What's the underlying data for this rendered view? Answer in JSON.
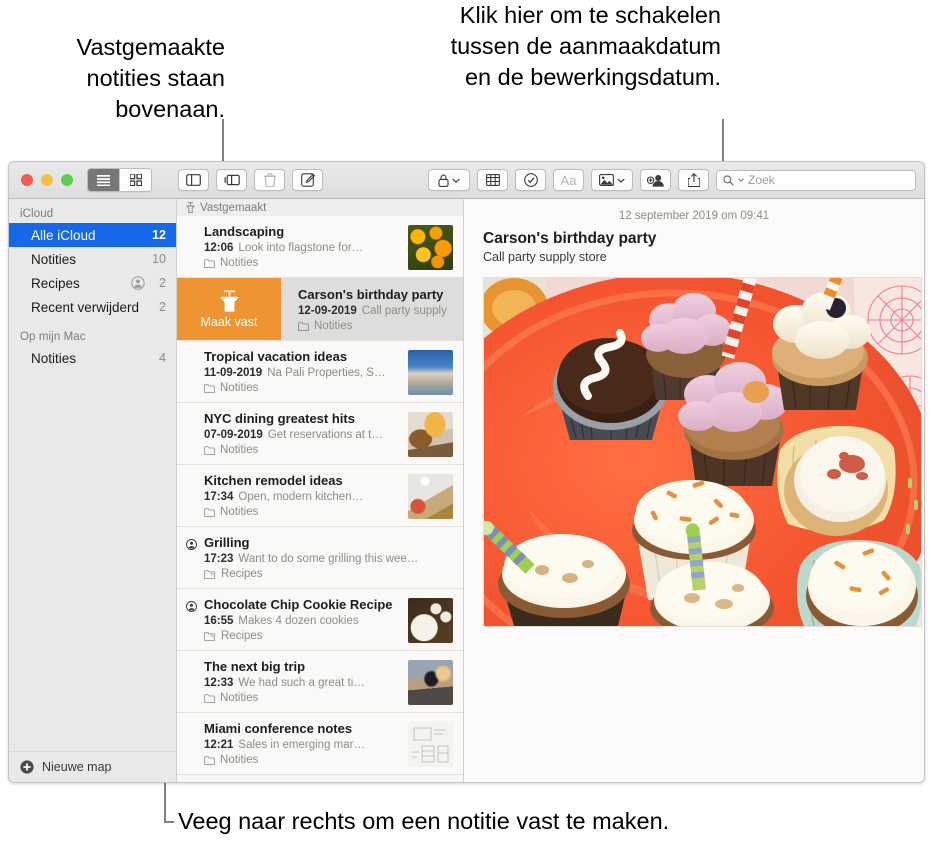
{
  "callouts": {
    "pinned": "Vastgemaakte notities staan bovenaan.",
    "date_toggle": "Klik hier om te schakelen tussen de aanmaakdatum en de bewerkingsdatum.",
    "swipe": "Veeg naar rechts om een notitie vast te maken."
  },
  "toolbar": {
    "window_controls": [
      "close",
      "minimize",
      "maximize"
    ],
    "view_list_label": "list-view",
    "view_grid_label": "gallery-view",
    "buttons": [
      {
        "name": "sidebar-toggle",
        "icon": "sidebar-icon"
      },
      {
        "name": "folders-toggle",
        "icon": "folder-list-icon"
      },
      {
        "name": "delete-note",
        "icon": "trash-icon",
        "disabled": true
      },
      {
        "name": "compose-note",
        "icon": "compose-icon"
      },
      {
        "name": "lock-note",
        "icon": "lock-icon",
        "chevron": true
      },
      {
        "name": "add-table",
        "icon": "table-icon"
      },
      {
        "name": "checklist",
        "icon": "checkmark-circle-icon"
      },
      {
        "name": "format",
        "icon": "aa-icon",
        "disabled": true
      },
      {
        "name": "add-media",
        "icon": "photo-icon",
        "chevron": true
      },
      {
        "name": "add-people",
        "icon": "add-person-icon"
      },
      {
        "name": "share",
        "icon": "share-icon"
      }
    ],
    "search": {
      "placeholder": "Zoek",
      "icon": "search-icon"
    }
  },
  "sidebar": {
    "sections": [
      {
        "header": "iCloud",
        "items": [
          {
            "label": "Alle iCloud",
            "count": "12",
            "selected": true,
            "shared": false
          },
          {
            "label": "Notities",
            "count": "10",
            "selected": false,
            "shared": false
          },
          {
            "label": "Recipes",
            "count": "2",
            "selected": false,
            "shared": true
          },
          {
            "label": "Recent verwijderd",
            "count": "2",
            "selected": false,
            "shared": false
          }
        ]
      },
      {
        "header": "Op mijn Mac",
        "items": [
          {
            "label": "Notities",
            "count": "4",
            "selected": false,
            "shared": false
          }
        ]
      }
    ],
    "new_folder_label": "Nieuwe map"
  },
  "notes_list": {
    "pinned_header": "Vastgemaakt",
    "pin_action_label": "Maak vast",
    "items": [
      {
        "title": "Landscaping",
        "time": "12:06",
        "preview": "Look into flagstone for…",
        "folder": "Notities",
        "shared": false,
        "folder_shared": false,
        "thumb": "flowers"
      },
      {
        "title": "Carson's birthday party",
        "time": "12-09-2019",
        "preview": "Call party supply",
        "folder": "Notities",
        "shared": false,
        "folder_shared": false,
        "thumb": "none",
        "swiped": true
      },
      {
        "title": "Tropical vacation ideas",
        "time": "11-09-2019",
        "preview": "Na Pali Properties, S…",
        "folder": "Notities",
        "shared": false,
        "folder_shared": false,
        "thumb": "coast"
      },
      {
        "title": "NYC dining greatest hits",
        "time": "07-09-2019",
        "preview": "Get reservations at t…",
        "folder": "Notities",
        "shared": false,
        "folder_shared": false,
        "thumb": "burger"
      },
      {
        "title": "Kitchen remodel ideas",
        "time": "17:34",
        "preview": "Open, modern kitchen…",
        "folder": "Notities",
        "shared": false,
        "folder_shared": false,
        "thumb": "kitchen"
      },
      {
        "title": "Grilling",
        "time": "17:23",
        "preview": "Want to do some grilling this wee…",
        "folder": "Recipes",
        "shared": true,
        "folder_shared": true,
        "thumb": "none"
      },
      {
        "title": "Chocolate Chip Cookie Recipe",
        "time": "16:55",
        "preview": "Makes 4 dozen cookies",
        "folder": "Recipes",
        "shared": true,
        "folder_shared": true,
        "thumb": "cookies"
      },
      {
        "title": "The next big trip",
        "time": "12:33",
        "preview": "We had such a great ti…",
        "folder": "Notities",
        "shared": false,
        "folder_shared": false,
        "thumb": "bike"
      },
      {
        "title": "Miami conference notes",
        "time": "12:21",
        "preview": "Sales in emerging mar…",
        "folder": "Notities",
        "shared": false,
        "folder_shared": false,
        "thumb": "sketch"
      }
    ]
  },
  "detail": {
    "date": "12 september 2019 om 09:41",
    "title": "Carson's birthday party",
    "body": "Call party supply store",
    "photo_alt": "cupcakes-on-orange-plate"
  },
  "colors": {
    "selection_blue": "#1569e8",
    "pin_orange": "#ef9432",
    "window_bg": "#ececec",
    "sidebar_bg": "#e9e9e9",
    "list_bg": "#f7f6f4"
  }
}
